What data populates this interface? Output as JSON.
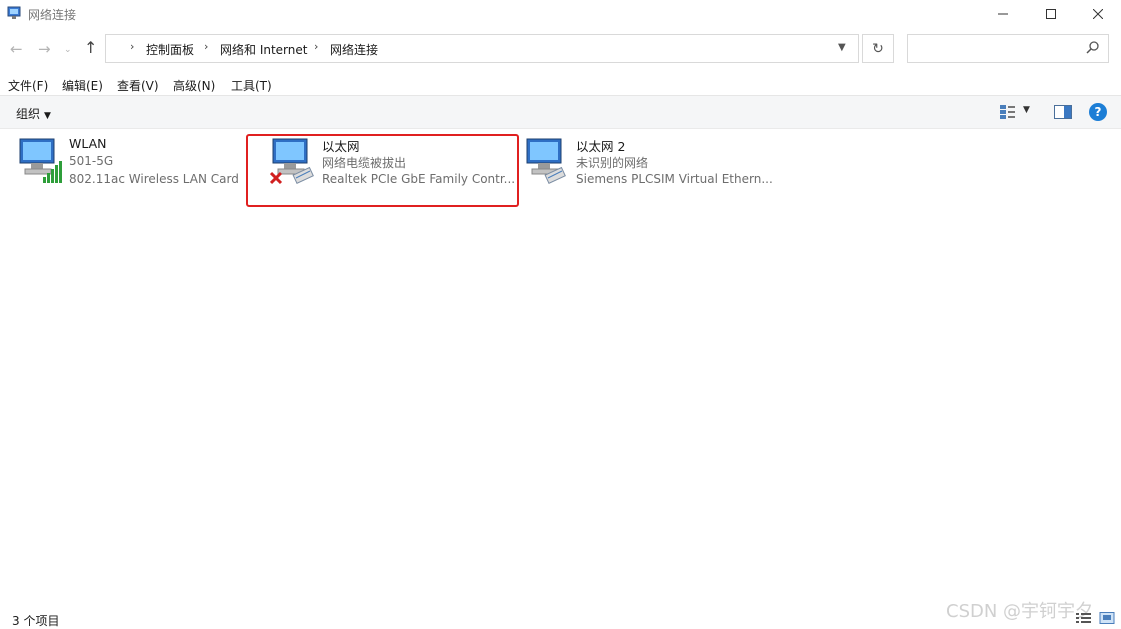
{
  "window": {
    "title": "网络连接"
  },
  "address": {
    "breadcrumbs": [
      "控制面板",
      "网络和 Internet",
      "网络连接"
    ],
    "search_placeholder": ""
  },
  "menu": [
    "文件(F)",
    "编辑(E)",
    "查看(V)",
    "高级(N)",
    "工具(T)"
  ],
  "toolbar": {
    "organize_label": "组织"
  },
  "connections": [
    {
      "name": "WLAN",
      "status": "501-5G",
      "device": "802.11ac Wireless LAN Card",
      "icon": "wifi-signal"
    },
    {
      "name": "以太网",
      "status": "网络电缆被拔出",
      "device": "Realtek PCIe GbE Family Contr...",
      "icon": "ethernet-disconnected",
      "highlighted": true
    },
    {
      "name": "以太网 2",
      "status": "未识别的网络",
      "device": "Siemens PLCSIM Virtual Ethern...",
      "icon": "ethernet"
    }
  ],
  "statusbar": {
    "count": "3 个项目"
  },
  "watermark": "CSDN @宇钶宇夕",
  "colors": {
    "highlight": "#e02020",
    "help": "#1c7ed6",
    "signal": "#2e9e3a"
  }
}
